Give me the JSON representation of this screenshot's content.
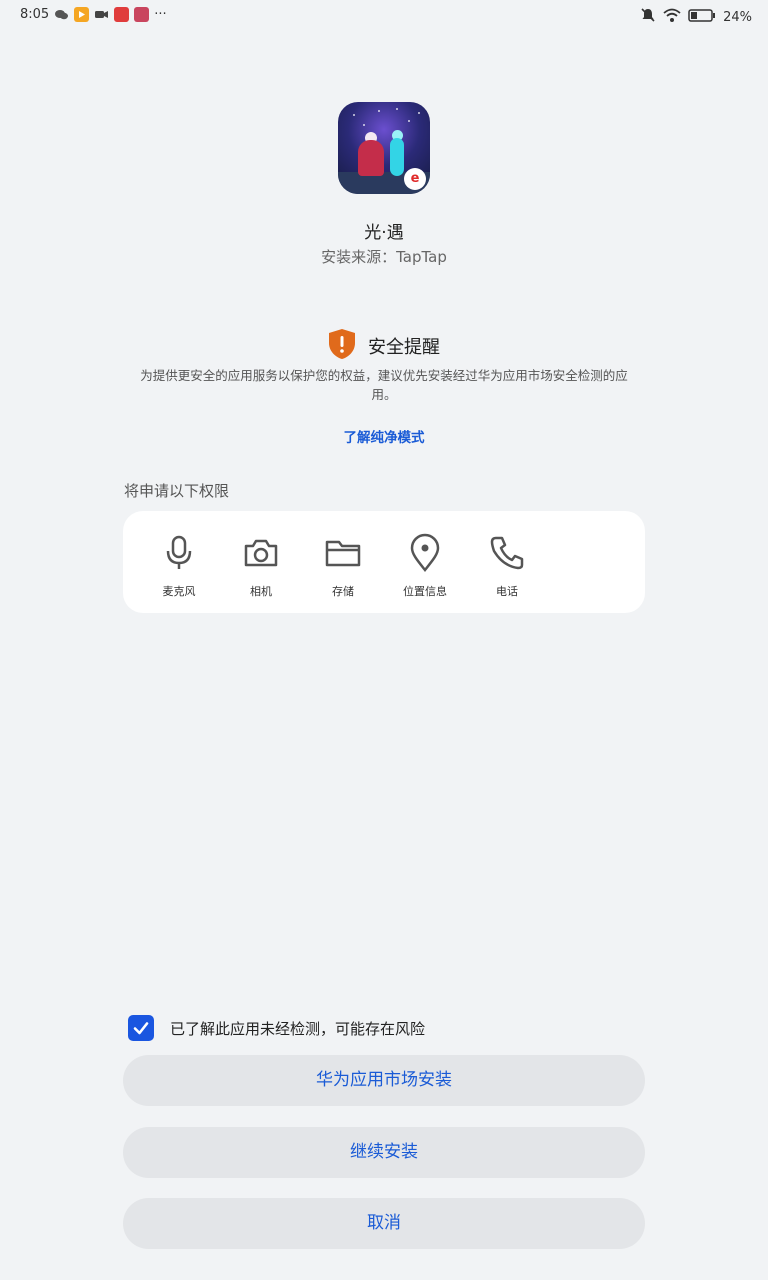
{
  "status_bar": {
    "time": "8:05",
    "battery": "24%",
    "icons": [
      "wechat-icon",
      "video-app-icon",
      "video-call-icon",
      "media-app-icon",
      "game-app-icon",
      "more-icon",
      "mute-bell-icon",
      "wifi-icon",
      "battery-icon"
    ]
  },
  "app": {
    "name": "光·遇",
    "source": "安装来源：TapTap",
    "badge": "e"
  },
  "security": {
    "title": "安全提醒",
    "description": "为提供更安全的应用服务以保护您的权益，建议优先安装经过华为应用市场安全检测的应用。",
    "link": "了解纯净模式",
    "accent_color": "#e06a1b"
  },
  "permissions": {
    "heading": "将申请以下权限",
    "items": [
      {
        "label": "麦克风",
        "icon": "microphone-icon"
      },
      {
        "label": "相机",
        "icon": "camera-icon"
      },
      {
        "label": "存储",
        "icon": "folder-icon"
      },
      {
        "label": "位置信息",
        "icon": "location-icon"
      },
      {
        "label": "电话",
        "icon": "phone-icon"
      }
    ]
  },
  "acknowledge": {
    "checked": true,
    "label": "已了解此应用未经检测，可能存在风险"
  },
  "buttons": {
    "huawei_install": "华为应用市场安装",
    "continue_install": "继续安装",
    "cancel": "取消"
  },
  "colors": {
    "link_blue": "#1a5bd6",
    "checkbox_blue": "#1a56e0",
    "background": "#f1f3f5"
  }
}
